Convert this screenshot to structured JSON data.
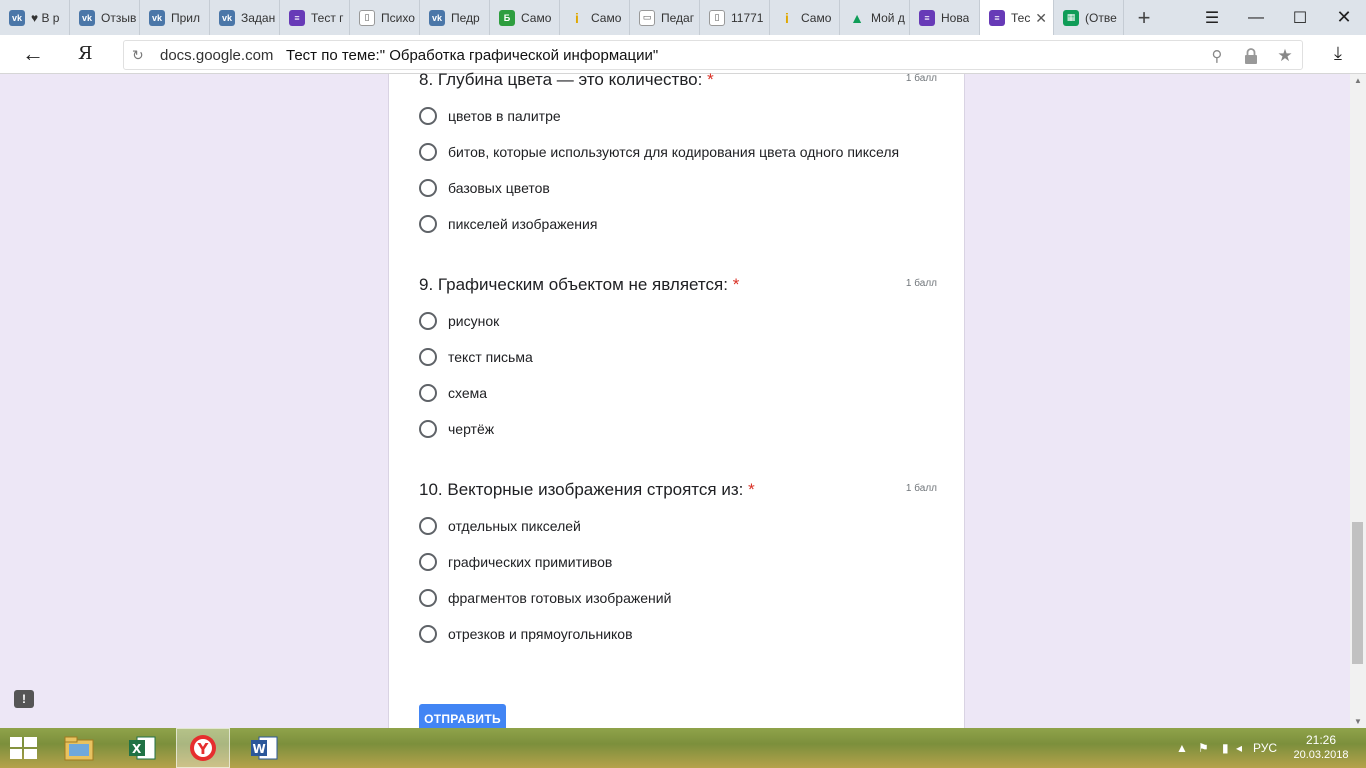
{
  "browser": {
    "tabs": [
      {
        "icon": "vk-icon",
        "label": "♥ В р",
        "color": "#4a76a8",
        "glyph": "vk"
      },
      {
        "icon": "vk-icon",
        "label": "Отзыв",
        "color": "#4a76a8",
        "glyph": "vk"
      },
      {
        "icon": "vk-icon",
        "label": "Прил",
        "color": "#4a76a8",
        "glyph": "vk"
      },
      {
        "icon": "vk-icon",
        "label": "Задан",
        "color": "#4a76a8",
        "glyph": "vk"
      },
      {
        "icon": "forms-icon",
        "label": "Тест г",
        "color": "#673ab7",
        "glyph": "≡"
      },
      {
        "icon": "document-icon",
        "label": "Психо",
        "color": "#ffffff",
        "glyph": "▯"
      },
      {
        "icon": "vk-icon",
        "label": "Педр",
        "color": "#4a76a8",
        "glyph": "vk"
      },
      {
        "icon": "b-icon",
        "label": "Само",
        "color": "#2e9e3f",
        "glyph": "Б"
      },
      {
        "icon": "info-icon",
        "label": "Само",
        "color": "#f3c623",
        "glyph": "i"
      },
      {
        "icon": "presentation-icon",
        "label": "Педаг",
        "color": "#ffffff",
        "glyph": "▭"
      },
      {
        "icon": "document-icon",
        "label": "11771",
        "color": "#ffffff",
        "glyph": "▯"
      },
      {
        "icon": "info-icon",
        "label": "Само",
        "color": "#f3c623",
        "glyph": "i"
      },
      {
        "icon": "drive-icon",
        "label": "Мой д",
        "color": "#0f9d58",
        "glyph": "▲"
      },
      {
        "icon": "forms-icon",
        "label": "Нова",
        "color": "#673ab7",
        "glyph": "≡"
      },
      {
        "icon": "forms-icon",
        "label": "Тес",
        "color": "#673ab7",
        "glyph": "≡",
        "active": true
      },
      {
        "icon": "sheets-icon",
        "label": "(Отве",
        "color": "#0f9d58",
        "glyph": "▦"
      }
    ],
    "new_tab": "+",
    "yandex_label": "Я",
    "host": "docs.google.com",
    "page_title": "Тест по теме:\" Обработка графической информации\""
  },
  "form": {
    "questions": [
      {
        "number": "8.",
        "title": "8. Глубина цвета — это количество:",
        "required": "*",
        "points": "1 балл",
        "options": [
          "цветов в палитре",
          "битов, которые используются для кодирования цвета одного пикселя",
          "базовых цветов",
          "пикселей изображения"
        ]
      },
      {
        "title": "9. Графическим объектом не является:",
        "required": "*",
        "points": "1 балл",
        "options": [
          "рисунок",
          "текст письма",
          "схема",
          "чертёж"
        ]
      },
      {
        "title": "10. Векторные изображения строятся из:",
        "required": "*",
        "points": "1 балл",
        "options": [
          "отдельных пикселей",
          "графических примитивов",
          "фрагментов готовых изображений",
          "отрезков и прямоугольников"
        ]
      }
    ],
    "submit_label": "ОТПРАВИТЬ",
    "feedback_label": "!"
  },
  "taskbar": {
    "lang": "РУС",
    "time": "21:26",
    "date": "20.03.2018",
    "apps": [
      {
        "icon": "explorer-icon"
      },
      {
        "icon": "excel-icon"
      },
      {
        "icon": "yandex-browser-icon",
        "active": true
      },
      {
        "icon": "word-icon"
      }
    ]
  },
  "colors": {
    "page_bg": "#ede7f6",
    "required": "#d93025",
    "submit": "#4285f4",
    "forms_purple": "#673ab7"
  }
}
